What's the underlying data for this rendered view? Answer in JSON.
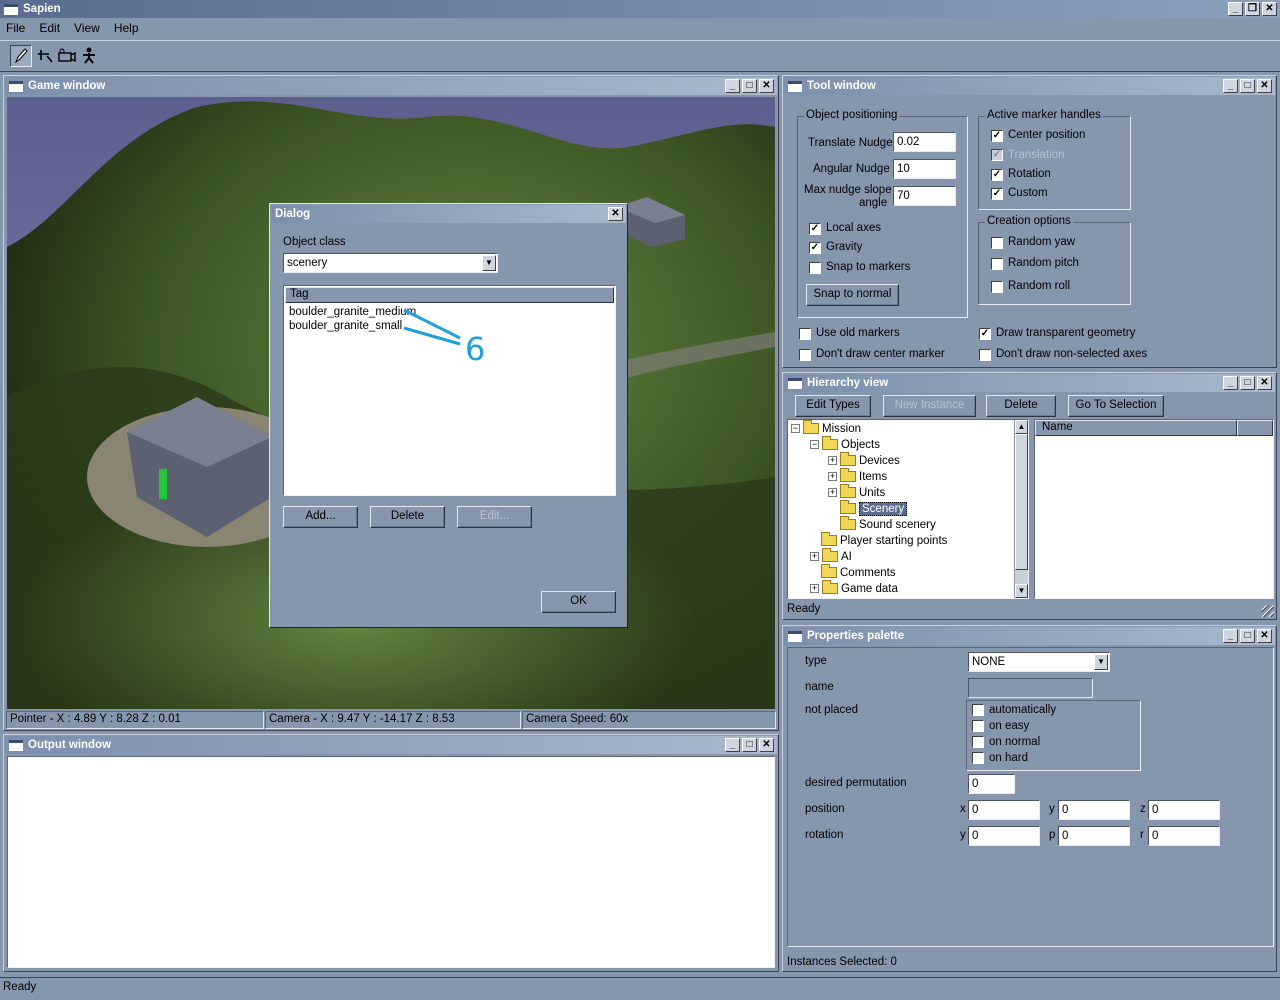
{
  "app": {
    "title": "Sapien",
    "menu": [
      "File",
      "Edit",
      "View",
      "Help"
    ],
    "status": "Ready"
  },
  "toolbar": {
    "icons": [
      "pencil-icon",
      "crosshair-icon",
      "camera-icon",
      "figure-icon"
    ]
  },
  "game_window": {
    "title": "Game window",
    "pointer": "Pointer - X : 4.89  Y : 8.28  Z : 0.01",
    "camera": "Camera - X : 9.47  Y : -14.17  Z : 8.53",
    "camera_speed": "Camera Speed: 60x"
  },
  "dialog": {
    "title": "Dialog",
    "object_class_label": "Object class",
    "object_class_value": "scenery",
    "tag_header": "Tag",
    "tags": [
      "boulder_granite_medium",
      "boulder_granite_small"
    ],
    "annotation": "6",
    "add": "Add...",
    "delete": "Delete",
    "edit": "Edit...",
    "ok": "OK"
  },
  "output_window": {
    "title": "Output window"
  },
  "tool_window": {
    "title": "Tool window",
    "object_positioning": "Object positioning",
    "translate_nudge_label": "Translate Nudge",
    "translate_nudge": "0.02",
    "angular_nudge_label": "Angular Nudge",
    "angular_nudge": "10",
    "max_nudge_label_1": "Max nudge slope",
    "max_nudge_label_2": "angle",
    "max_nudge": "70",
    "local_axes": "Local axes",
    "gravity": "Gravity",
    "snap_to_markers": "Snap to markers",
    "snap_to_normal": "Snap to normal",
    "active_marker_handles": "Active marker handles",
    "center_position": "Center position",
    "translation": "Translation",
    "rotation": "Rotation",
    "custom": "Custom",
    "creation_options": "Creation options",
    "random_yaw": "Random yaw",
    "random_pitch": "Random pitch",
    "random_roll": "Random roll",
    "use_old_markers": "Use old markers",
    "dont_draw_center": "Don't draw center marker",
    "draw_transparent": "Draw transparent geometry",
    "dont_draw_nonselected": "Don't draw non-selected axes"
  },
  "hierarchy": {
    "title": "Hierarchy view",
    "buttons": [
      "Edit Types",
      "New Instance",
      "Delete",
      "Go To Selection"
    ],
    "tree": [
      "Mission",
      "Objects",
      "Devices",
      "Items",
      "Units",
      "Scenery",
      "Sound scenery",
      "Player starting points",
      "AI",
      "Comments",
      "Game data"
    ],
    "name_header": "Name",
    "status": "Ready"
  },
  "properties": {
    "title": "Properties palette",
    "type_label": "type",
    "type_value": "NONE",
    "name_label": "name",
    "not_placed_label": "not placed",
    "not_placed_options": [
      "automatically",
      "on easy",
      "on normal",
      "on hard"
    ],
    "desired_perm_label": "desired permutation",
    "desired_perm": "0",
    "position_label": "position",
    "rotation_label": "rotation",
    "pos_axes": [
      "x",
      "y",
      "z"
    ],
    "rot_axes": [
      "y",
      "p",
      "r"
    ],
    "pos_values": [
      "0",
      "0",
      "0"
    ],
    "rot_values": [
      "0",
      "0",
      "0"
    ],
    "status": "Instances Selected: 0"
  },
  "colors": {
    "window_bg": "#8696ad",
    "title_active": "#4f6388",
    "annotation": "#1ea0dc"
  }
}
